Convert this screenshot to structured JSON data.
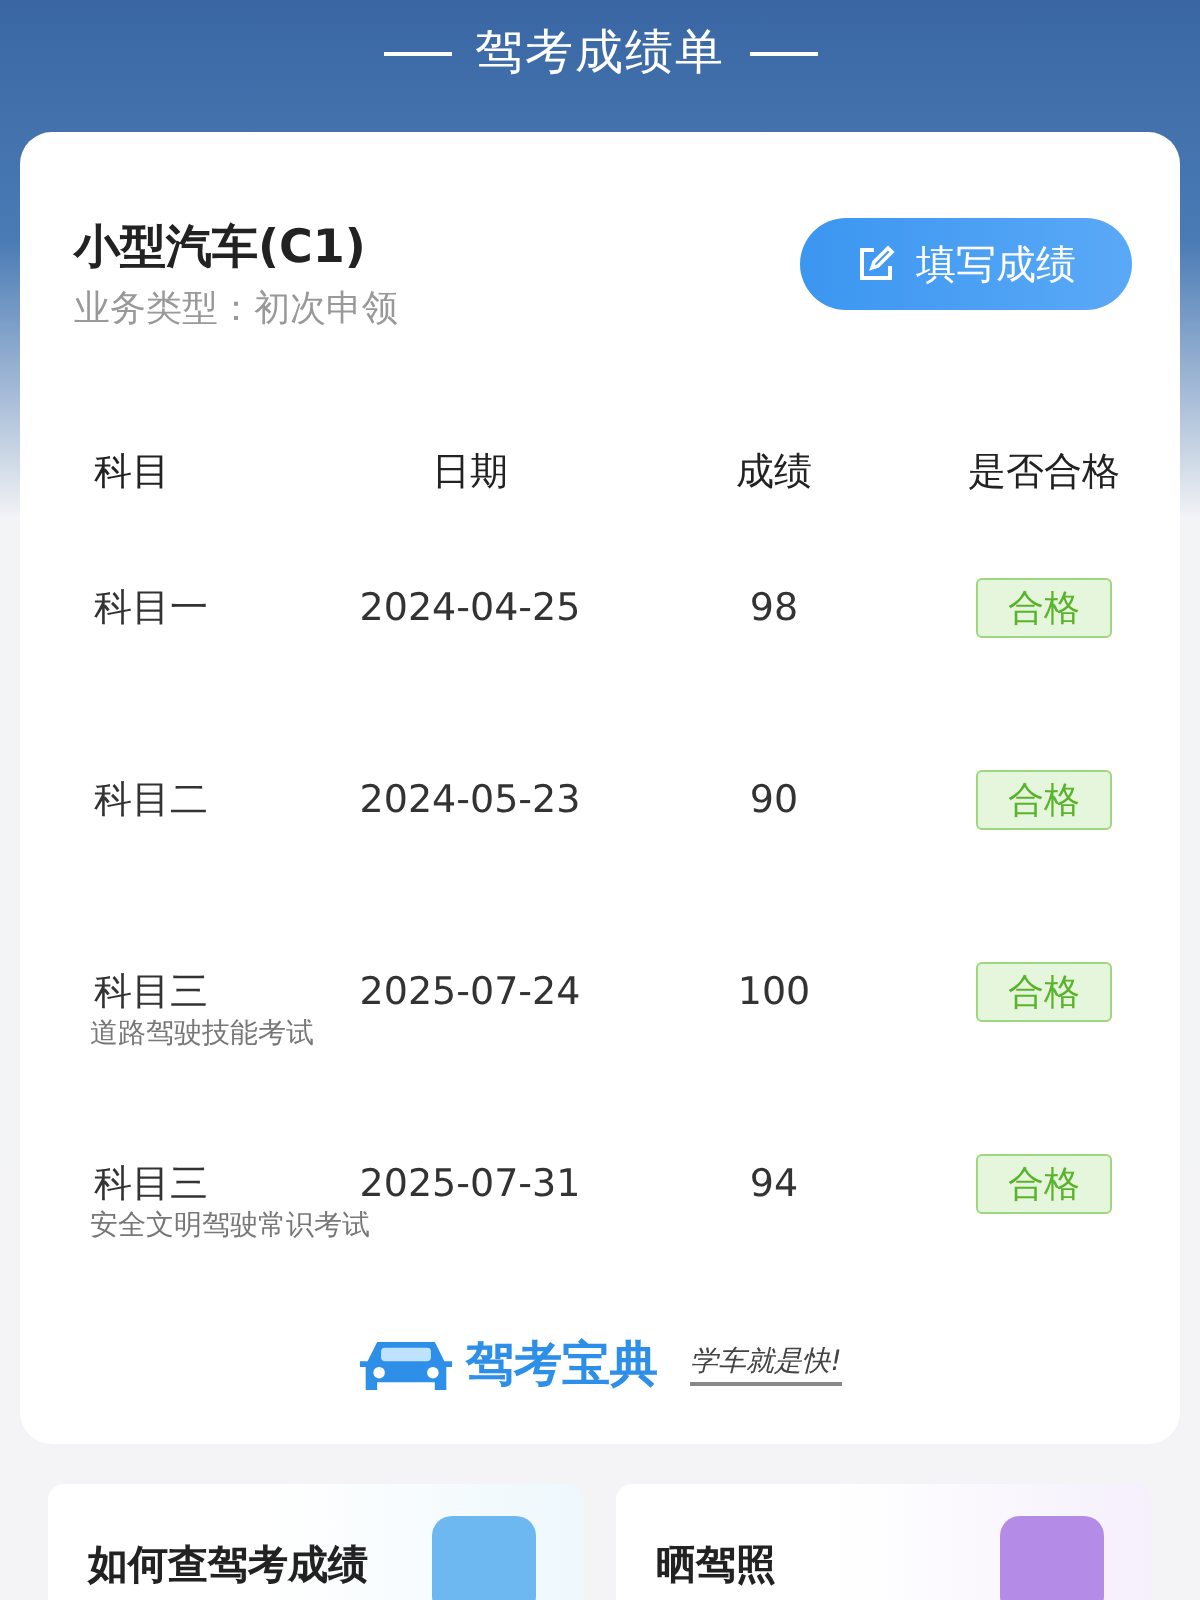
{
  "header": {
    "title": "驾考成绩单"
  },
  "card": {
    "vehicle": "小型汽车(C1)",
    "business_type": "业务类型：初次申领",
    "fill_button": "填写成绩",
    "columns": [
      "科目",
      "日期",
      "成绩",
      "是否合格"
    ],
    "rows": [
      {
        "subject": "科目一",
        "date": "2024-04-25",
        "score": "98",
        "result": "合格",
        "passed": true
      },
      {
        "subject": "科目二",
        "date": "2024-05-23",
        "score": "90",
        "result": "合格",
        "passed": true
      },
      {
        "subject": "科目三",
        "date": "2025-07-24",
        "score": "100",
        "result": "合格",
        "passed": true,
        "note": "道路驾驶技能考试"
      },
      {
        "subject": "科目三",
        "date": "2025-07-31",
        "score": "94",
        "result": "合格",
        "passed": true,
        "note": "安全文明驾驶常识考试"
      }
    ],
    "brand": {
      "name": "驾考宝典",
      "slogan": "学车就是快!"
    }
  },
  "tiles": [
    {
      "title": "如何查驾考成绩",
      "color": "#6db8f0"
    },
    {
      "title": "晒驾照",
      "color": "#b48be6"
    }
  ]
}
